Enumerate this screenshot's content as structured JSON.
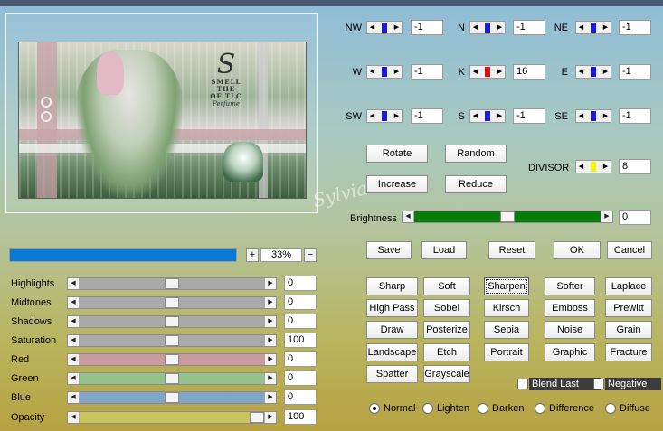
{
  "preview": {
    "logo_mark": "S",
    "logo_line1": "SMELL",
    "logo_line2": "THE",
    "logo_line3": "OF TLC",
    "logo_script": "Perfume",
    "watermark": "Sylviane"
  },
  "zoom": {
    "minus": "−",
    "plus": "+",
    "value": "33%",
    "progress_fraction": 1.0
  },
  "sliders": [
    {
      "label": "Highlights",
      "value": "0",
      "color": "#a9a9a9",
      "level": 0.5
    },
    {
      "label": "Midtones",
      "value": "0",
      "color": "#a9a9a9",
      "level": 0.5
    },
    {
      "label": "Shadows",
      "value": "0",
      "color": "#a9a9a9",
      "level": 0.5
    },
    {
      "label": "Saturation",
      "value": "100",
      "color": "#a9a9a9",
      "level": 0.5
    },
    {
      "label": "Red",
      "value": "0",
      "color": "#c99aa2",
      "level": 0.5
    },
    {
      "label": "Green",
      "value": "0",
      "color": "#94c28c",
      "level": 0.5
    },
    {
      "label": "Blue",
      "value": "0",
      "color": "#7fa6c4",
      "level": 0.5
    },
    {
      "label": "Opacity",
      "value": "100",
      "color": "#c8c65c",
      "level": 1.0
    }
  ],
  "directions": [
    {
      "label": "NW",
      "value": "-1"
    },
    {
      "label": "N",
      "value": "-1"
    },
    {
      "label": "NE",
      "value": "-1"
    },
    {
      "label": "W",
      "value": "-1"
    },
    {
      "label": "K",
      "value": "16"
    },
    {
      "label": "E",
      "value": "-1"
    },
    {
      "label": "SW",
      "value": "-1"
    },
    {
      "label": "S",
      "value": "-1"
    },
    {
      "label": "SE",
      "value": "-1"
    }
  ],
  "actions": {
    "rotate": "Rotate",
    "random": "Random",
    "increase": "Increase",
    "reduce": "Reduce"
  },
  "divisor": {
    "label": "DIVISOR",
    "value": "8"
  },
  "brightness": {
    "label": "Brightness",
    "value": "0",
    "level": 0.5
  },
  "file_buttons": {
    "save": "Save",
    "load": "Load",
    "reset": "Reset",
    "ok": "OK",
    "cancel": "Cancel"
  },
  "presets": [
    "Sharp",
    "Soft",
    "Sharpen",
    "Softer",
    "Laplace",
    "High Pass",
    "Sobel",
    "Kirsch",
    "Emboss",
    "Prewitt",
    "Draw",
    "Posterize",
    "Sepia",
    "Noise",
    "Grain",
    "Landscape",
    "Etch",
    "Portrait",
    "Graphic",
    "Fracture",
    "Spatter",
    "Grayscale"
  ],
  "options": {
    "blend_last": "Blend Last",
    "negative": "Negative"
  },
  "modes": [
    "Normal",
    "Lighten",
    "Darken",
    "Difference",
    "Diffuse"
  ],
  "selected_mode": "Normal"
}
